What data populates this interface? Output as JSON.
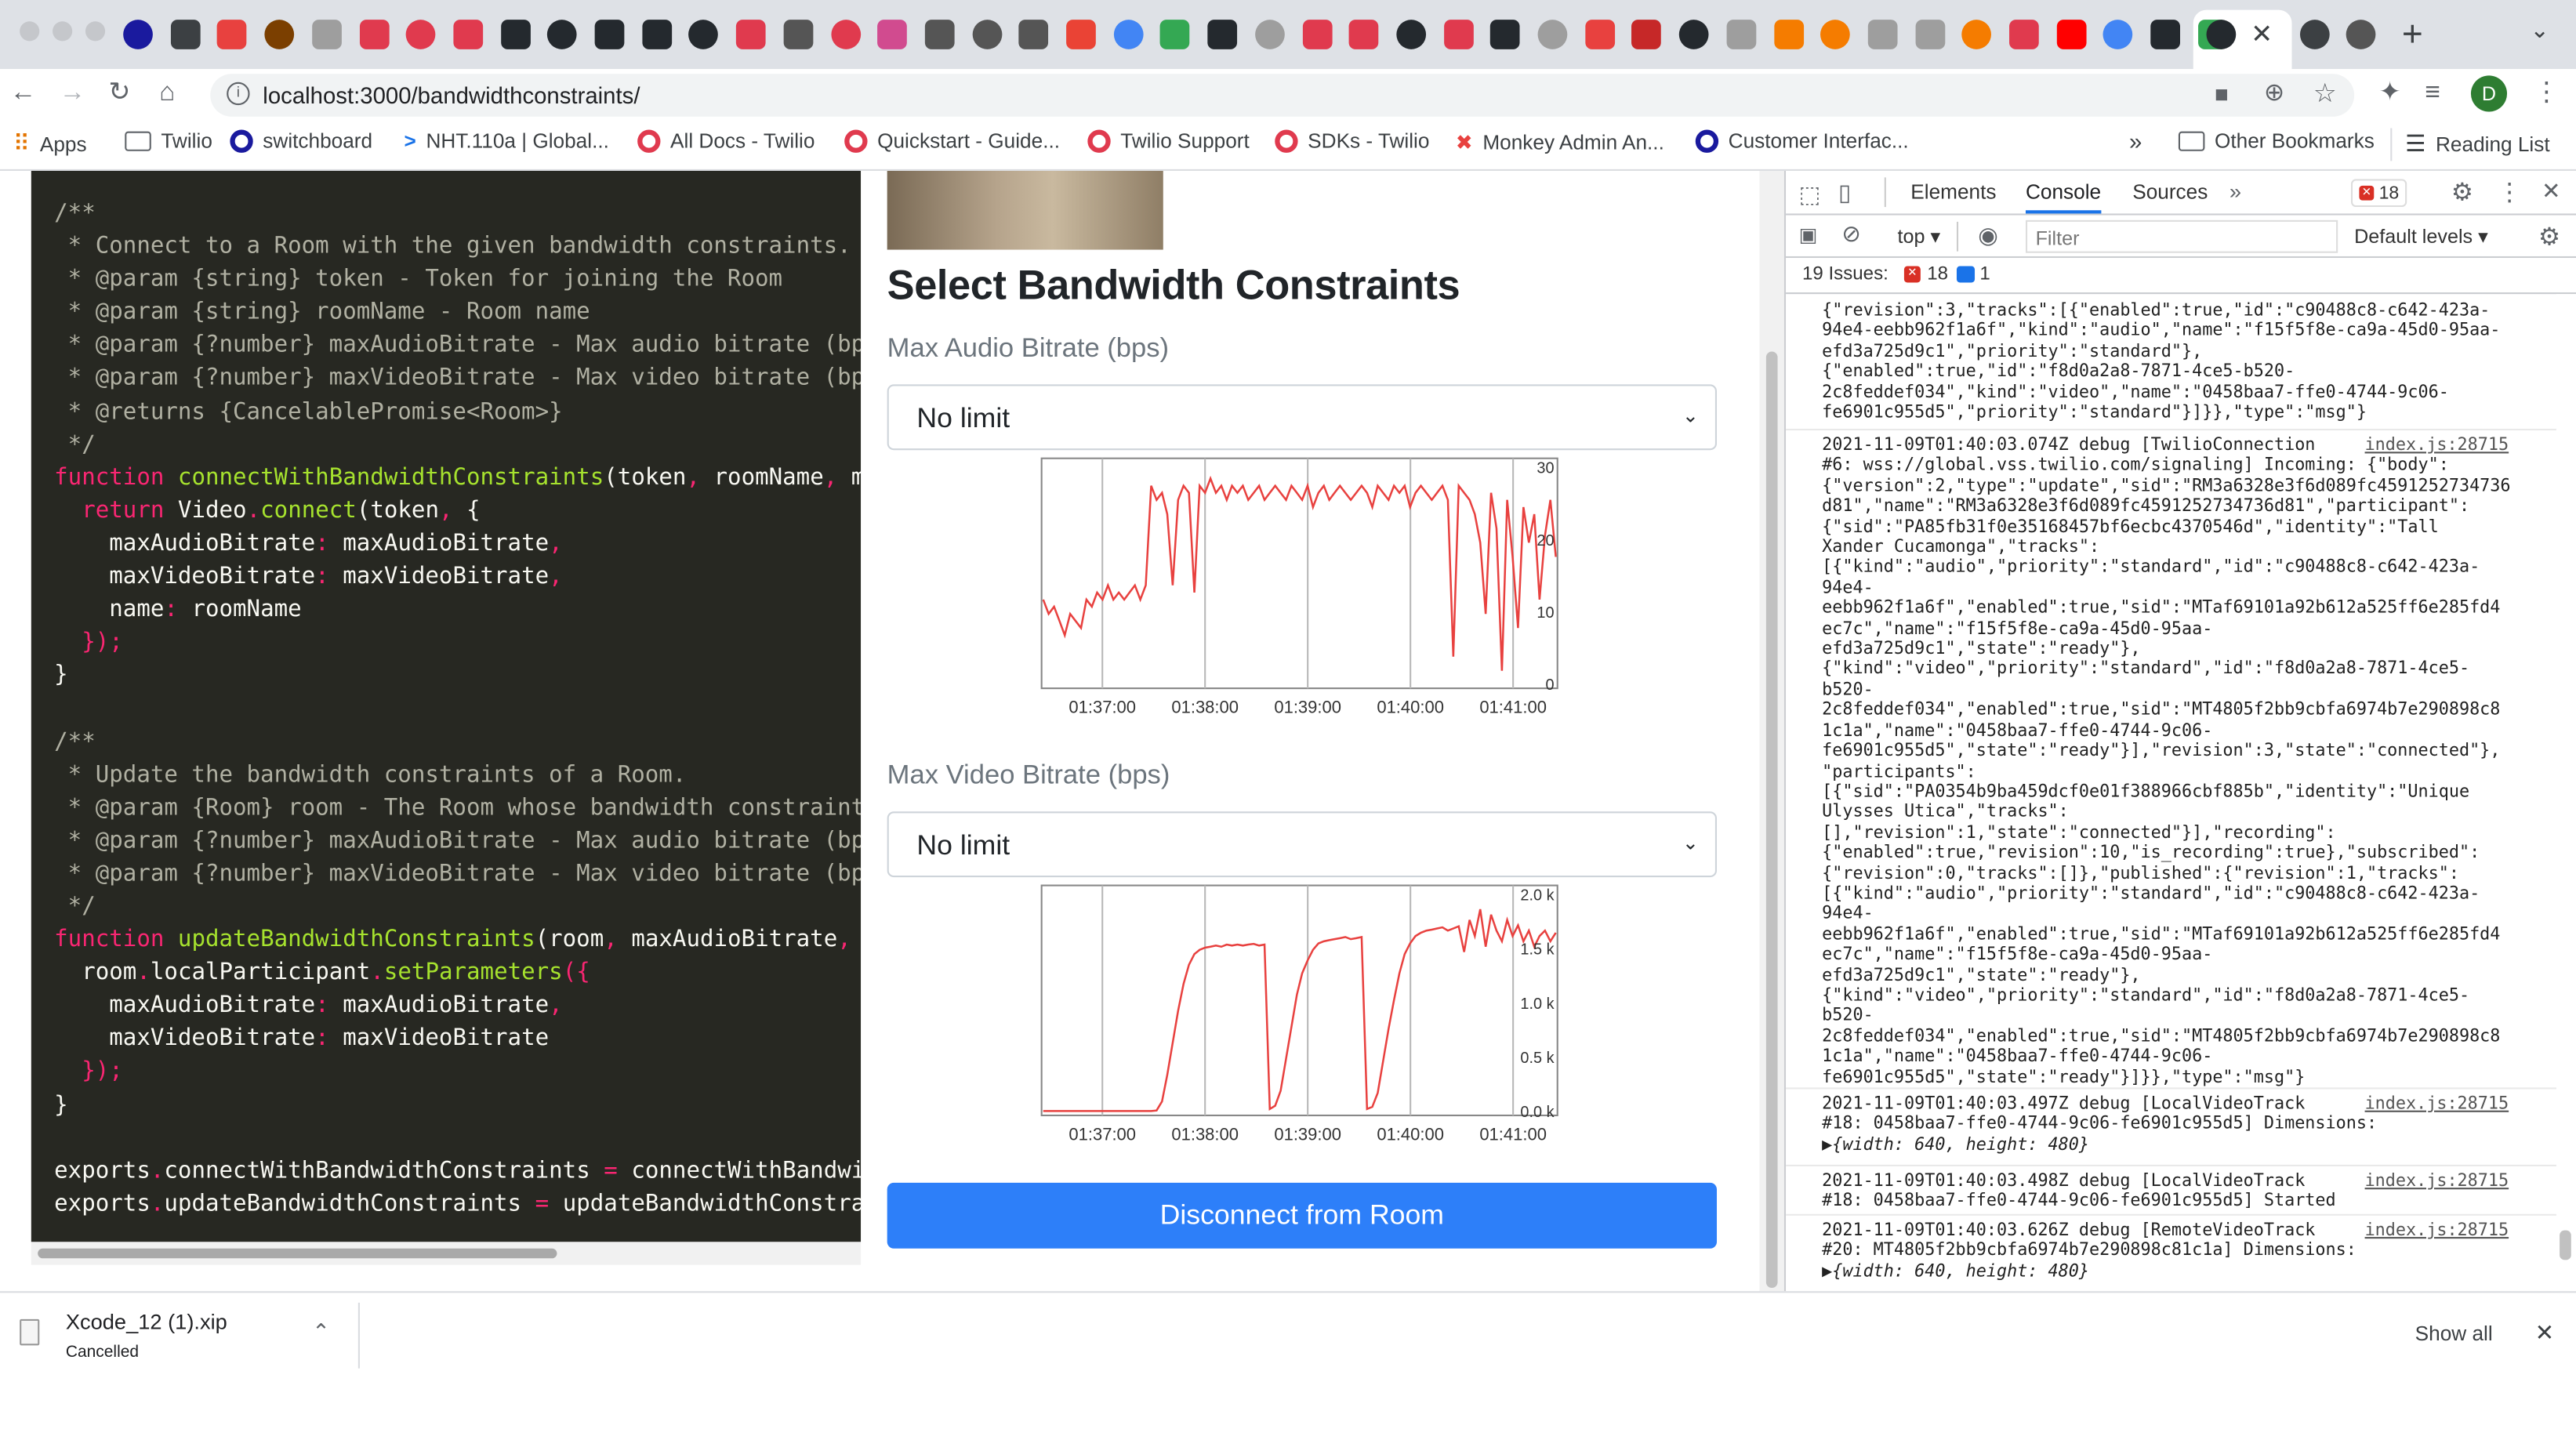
{
  "browser": {
    "url": "localhost:3000/bandwidthconstraints/",
    "profile_initial": "D",
    "bookmarks": [
      {
        "label": "Apps",
        "icon": "apps-grid-icon"
      },
      {
        "label": "Twilio",
        "icon": "folder-icon"
      },
      {
        "label": "switchboard",
        "icon": "circle-icon"
      },
      {
        "label": "NHT.110a | Global...",
        "icon": "chevron-icon"
      },
      {
        "label": "All Docs - Twilio",
        "icon": "twilio-icon"
      },
      {
        "label": "Quickstart - Guide...",
        "icon": "twilio-icon"
      },
      {
        "label": "Twilio Support",
        "icon": "twilio-icon"
      },
      {
        "label": "SDKs - Twilio",
        "icon": "twilio-icon"
      },
      {
        "label": "Monkey Admin An...",
        "icon": "monkey-icon"
      },
      {
        "label": "Customer Interfac...",
        "icon": "circle-icon"
      }
    ],
    "bookmarks_overflow": "»",
    "other_bookmarks": "Other Bookmarks",
    "reading_list": "Reading List"
  },
  "code": {
    "lines": [
      [
        {
          "c": "cc",
          "t": "/**"
        }
      ],
      [
        {
          "c": "cc",
          "t": " * Connect to a Room with the given bandwidth constraints."
        }
      ],
      [
        {
          "c": "cc",
          "t": " * @param {string} token - Token for joining the Room"
        }
      ],
      [
        {
          "c": "cc",
          "t": " * @param {string} roomName - Room name"
        }
      ],
      [
        {
          "c": "cc",
          "t": " * @param {?number} maxAudioBitrate - Max audio bitrate (bps)"
        }
      ],
      [
        {
          "c": "cc",
          "t": " * @param {?number} maxVideoBitrate - Max video bitrate (bps)"
        }
      ],
      [
        {
          "c": "cc",
          "t": " * @returns {CancelablePromise<Room>}"
        }
      ],
      [
        {
          "c": "cc",
          "t": " */"
        }
      ],
      [
        {
          "c": "kw",
          "t": "function "
        },
        {
          "c": "fn",
          "t": "connectWithBandwidthConstraints"
        },
        {
          "c": "",
          "t": "("
        },
        {
          "c": "",
          "t": "token"
        },
        {
          "c": "pu",
          "t": ", "
        },
        {
          "c": "",
          "t": "roomName"
        },
        {
          "c": "pu",
          "t": ", "
        },
        {
          "c": "",
          "t": "maxAudioBitrate, maxVideoBitrate) {"
        }
      ],
      [
        {
          "c": "",
          "t": "  "
        },
        {
          "c": "kw",
          "t": "return "
        },
        {
          "c": "",
          "t": "Video"
        },
        {
          "c": "pu",
          "t": "."
        },
        {
          "c": "fn",
          "t": "connect"
        },
        {
          "c": "",
          "t": "(token"
        },
        {
          "c": "pu",
          "t": ", "
        },
        {
          "c": "",
          "t": "{"
        }
      ],
      [
        {
          "c": "",
          "t": "    maxAudioBitrate"
        },
        {
          "c": "pu",
          "t": ": "
        },
        {
          "c": "",
          "t": "maxAudioBitrate"
        },
        {
          "c": "pu",
          "t": ","
        }
      ],
      [
        {
          "c": "",
          "t": "    maxVideoBitrate"
        },
        {
          "c": "pu",
          "t": ": "
        },
        {
          "c": "",
          "t": "maxVideoBitrate"
        },
        {
          "c": "pu",
          "t": ","
        }
      ],
      [
        {
          "c": "",
          "t": "    name"
        },
        {
          "c": "pu",
          "t": ": "
        },
        {
          "c": "",
          "t": "roomName"
        }
      ],
      [
        {
          "c": "",
          "t": "  "
        },
        {
          "c": "pu",
          "t": "});"
        }
      ],
      [
        {
          "c": "",
          "t": "}"
        }
      ],
      [
        {
          "c": "",
          "t": ""
        }
      ],
      [
        {
          "c": "cc",
          "t": "/**"
        }
      ],
      [
        {
          "c": "cc",
          "t": " * Update the bandwidth constraints of a Room."
        }
      ],
      [
        {
          "c": "cc",
          "t": " * @param {Room} room - The Room whose bandwidth constraints have to be updated"
        }
      ],
      [
        {
          "c": "cc",
          "t": " * @param {?number} maxAudioBitrate - Max audio bitrate (bps)"
        }
      ],
      [
        {
          "c": "cc",
          "t": " * @param {?number} maxVideoBitrate - Max video bitrate (bps)"
        }
      ],
      [
        {
          "c": "cc",
          "t": " */"
        }
      ],
      [
        {
          "c": "kw",
          "t": "function "
        },
        {
          "c": "fn",
          "t": "updateBandwidthConstraints"
        },
        {
          "c": "",
          "t": "(room"
        },
        {
          "c": "pu",
          "t": ", "
        },
        {
          "c": "",
          "t": "maxAudioBitrate"
        },
        {
          "c": "pu",
          "t": ", "
        },
        {
          "c": "",
          "t": "maxVideoBitrate) {"
        }
      ],
      [
        {
          "c": "",
          "t": "  room"
        },
        {
          "c": "pu",
          "t": "."
        },
        {
          "c": "",
          "t": "localParticipant"
        },
        {
          "c": "pu",
          "t": "."
        },
        {
          "c": "fn",
          "t": "setParameters"
        },
        {
          "c": "pu",
          "t": "({"
        }
      ],
      [
        {
          "c": "",
          "t": "    maxAudioBitrate"
        },
        {
          "c": "pu",
          "t": ": "
        },
        {
          "c": "",
          "t": "maxAudioBitrate"
        },
        {
          "c": "pu",
          "t": ","
        }
      ],
      [
        {
          "c": "",
          "t": "    maxVideoBitrate"
        },
        {
          "c": "pu",
          "t": ": "
        },
        {
          "c": "",
          "t": "maxVideoBitrate"
        }
      ],
      [
        {
          "c": "",
          "t": "  "
        },
        {
          "c": "pu",
          "t": "});"
        }
      ],
      [
        {
          "c": "",
          "t": "}"
        }
      ],
      [
        {
          "c": "",
          "t": ""
        }
      ],
      [
        {
          "c": "",
          "t": "exports"
        },
        {
          "c": "pu",
          "t": "."
        },
        {
          "c": "",
          "t": "connectWithBandwidthConstraints "
        },
        {
          "c": "pu",
          "t": "= "
        },
        {
          "c": "",
          "t": "connectWithBandwidthConstraints;"
        }
      ],
      [
        {
          "c": "",
          "t": "exports"
        },
        {
          "c": "pu",
          "t": "."
        },
        {
          "c": "",
          "t": "updateBandwidthConstraints "
        },
        {
          "c": "pu",
          "t": "= "
        },
        {
          "c": "",
          "t": "updateBandwidthConstraints;"
        }
      ]
    ]
  },
  "app": {
    "heading": "Select Bandwidth Constraints",
    "audio_label": "Max Audio Bitrate (bps)",
    "audio_value": "No limit",
    "video_label": "Max Video Bitrate (bps)",
    "video_value": "No limit",
    "disconnect_label": "Disconnect from Room"
  },
  "chart_data": [
    {
      "type": "line",
      "title": "",
      "x": [
        "01:37:00",
        "01:38:00",
        "01:39:00",
        "01:40:00",
        "01:41:00"
      ],
      "ylim": [
        0,
        30
      ],
      "yticks": [
        "30",
        "20",
        "10",
        "0"
      ],
      "color": "#e8413f",
      "series": [
        {
          "values": [
            12,
            10,
            11,
            9,
            7,
            10,
            9,
            8,
            12,
            11,
            13,
            12,
            14,
            12,
            13,
            12,
            13,
            14,
            12,
            14,
            28,
            26,
            27,
            24,
            14,
            26,
            28,
            27,
            13,
            28,
            27,
            29,
            27,
            28,
            26,
            28,
            27,
            28,
            26,
            27,
            28,
            26,
            27,
            28,
            27,
            26,
            28,
            27,
            26,
            28,
            25,
            27,
            28,
            26,
            27,
            28,
            27,
            26,
            27,
            28,
            27,
            25,
            28,
            27,
            26,
            28,
            27,
            28,
            25,
            27,
            28,
            27,
            26,
            27,
            28,
            26,
            4,
            28,
            27,
            26,
            24,
            20,
            10,
            27,
            22,
            2,
            26,
            18,
            8,
            25,
            20,
            24,
            12,
            21,
            26,
            18
          ]
        }
      ]
    },
    {
      "type": "line",
      "title": "",
      "x": [
        "01:37:00",
        "01:38:00",
        "01:39:00",
        "01:40:00",
        "01:41:00"
      ],
      "ylim": [
        0,
        2000
      ],
      "yticks": [
        "2.0 k",
        "1.5 k",
        "1.0 k",
        "0.5 k",
        "0.0 k"
      ],
      "color": "#e8413f",
      "series": [
        {
          "values": [
            10,
            10,
            10,
            10,
            10,
            10,
            10,
            10,
            10,
            10,
            10,
            10,
            10,
            10,
            10,
            10,
            10,
            10,
            10,
            10,
            10,
            15,
            100,
            350,
            650,
            950,
            1200,
            1380,
            1480,
            1520,
            1540,
            1550,
            1560,
            1550,
            1570,
            1560,
            1570,
            1560,
            1570,
            1575,
            1560,
            1570,
            30,
            60,
            200,
            500,
            800,
            1100,
            1300,
            1420,
            1520,
            1580,
            1600,
            1610,
            1620,
            1630,
            1640,
            1620,
            1630,
            1640,
            30,
            50,
            180,
            480,
            780,
            1050,
            1300,
            1480,
            1580,
            1650,
            1680,
            1700,
            1710,
            1720,
            1730,
            1700,
            1720,
            1740,
            1500,
            1800,
            1650,
            1900,
            1550,
            1850,
            1700,
            1600,
            1800,
            1650,
            1750,
            1600,
            1700,
            1550,
            1650,
            1700,
            1600,
            1680
          ]
        }
      ]
    }
  ],
  "devtools": {
    "tabs": [
      "Elements",
      "Console",
      "Sources"
    ],
    "active_tab": "Console",
    "error_count": "18",
    "context": "top",
    "filter_placeholder": "Filter",
    "levels": "Default levels",
    "issues_label": "19 Issues:",
    "issues_errors": "18",
    "issues_info": "1",
    "messages": [
      {
        "lines": [
          "{\"revision\":3,\"tracks\":[{\"enabled\":true,\"id\":\"c90488c8-c642-423a-",
          "94e4-eebb962f1a6f\",\"kind\":\"audio\",\"name\":\"f15f5f8e-ca9a-45d0-95aa-",
          "efd3a725d9c1\",\"priority\":\"standard\"},",
          "{\"enabled\":true,\"id\":\"f8d0a2a8-7871-4ce5-b520-",
          "2c8feddef034\",\"kind\":\"video\",\"name\":\"0458baa7-ffe0-4744-9c06-",
          "fe6901c955d5\",\"priority\":\"standard\"}]}},\"type\":\"msg\"}"
        ],
        "source": ""
      },
      {
        "lines": [
          "2021-11-09T01:40:03.074Z debug [TwilioConnection",
          "#6: wss://global.vss.twilio.com/signaling] Incoming: {\"body\":",
          "{\"version\":2,\"type\":\"update\",\"sid\":\"RM3a6328e3f6d089fc4591252734736",
          "d81\",\"name\":\"RM3a6328e3f6d089fc4591252734736d81\",\"participant\":",
          "{\"sid\":\"PA85fb31f0e35168457bf6ecbc4370546d\",\"identity\":\"Tall",
          "Xander Cucamonga\",\"tracks\":",
          "[{\"kind\":\"audio\",\"priority\":\"standard\",\"id\":\"c90488c8-c642-423a-",
          "94e4-",
          "eebb962f1a6f\",\"enabled\":true,\"sid\":\"MTaf69101a92b612a525ff6e285fd4",
          "ec7c\",\"name\":\"f15f5f8e-ca9a-45d0-95aa-",
          "efd3a725d9c1\",\"state\":\"ready\"},",
          "{\"kind\":\"video\",\"priority\":\"standard\",\"id\":\"f8d0a2a8-7871-4ce5-",
          "b520-",
          "2c8feddef034\",\"enabled\":true,\"sid\":\"MT4805f2bb9cbfa6974b7e290898c8",
          "1c1a\",\"name\":\"0458baa7-ffe0-4744-9c06-",
          "fe6901c955d5\",\"state\":\"ready\"}],\"revision\":3,\"state\":\"connected\"},",
          "\"participants\":",
          "[{\"sid\":\"PA0354b9ba459dcf0e01f388966cbf885b\",\"identity\":\"Unique",
          "Ulysses Utica\",\"tracks\":",
          "[],\"revision\":1,\"state\":\"connected\"}],\"recording\":",
          "{\"enabled\":true,\"revision\":10,\"is_recording\":true},\"subscribed\":",
          "{\"revision\":0,\"tracks\":[]},\"published\":{\"revision\":1,\"tracks\":",
          "[{\"kind\":\"audio\",\"priority\":\"standard\",\"id\":\"c90488c8-c642-423a-",
          "94e4-",
          "eebb962f1a6f\",\"enabled\":true,\"sid\":\"MTaf69101a92b612a525ff6e285fd4",
          "ec7c\",\"name\":\"f15f5f8e-ca9a-45d0-95aa-",
          "efd3a725d9c1\",\"state\":\"ready\"},",
          "{\"kind\":\"video\",\"priority\":\"standard\",\"id\":\"f8d0a2a8-7871-4ce5-",
          "b520-",
          "2c8feddef034\",\"enabled\":true,\"sid\":\"MT4805f2bb9cbfa6974b7e290898c8",
          "1c1a\",\"name\":\"0458baa7-ffe0-4744-9c06-",
          "fe6901c955d5\",\"state\":\"ready\"}]}},\"type\":\"msg\"}"
        ],
        "source": "index.js:28715"
      },
      {
        "lines": [
          "2021-11-09T01:40:03.497Z debug [LocalVideoTrack",
          "#18: 0458baa7-ffe0-4744-9c06-fe6901c955d5] Dimensions:",
          "▶{width: 640, height: 480}"
        ],
        "source": "index.js:28715"
      },
      {
        "lines": [
          "2021-11-09T01:40:03.498Z debug [LocalVideoTrack",
          "#18: 0458baa7-ffe0-4744-9c06-fe6901c955d5] Started"
        ],
        "source": "index.js:28715"
      },
      {
        "lines": [
          "2021-11-09T01:40:03.626Z debug [RemoteVideoTrack",
          "#20: MT4805f2bb9cbfa6974b7e290898c81c1a] Dimensions:",
          "▶{width: 640, height: 480}"
        ],
        "source": "index.js:28715"
      }
    ]
  },
  "shelf": {
    "file_name": "Xcode_12 (1).xip",
    "file_status": "Cancelled",
    "show_all": "Show all"
  }
}
